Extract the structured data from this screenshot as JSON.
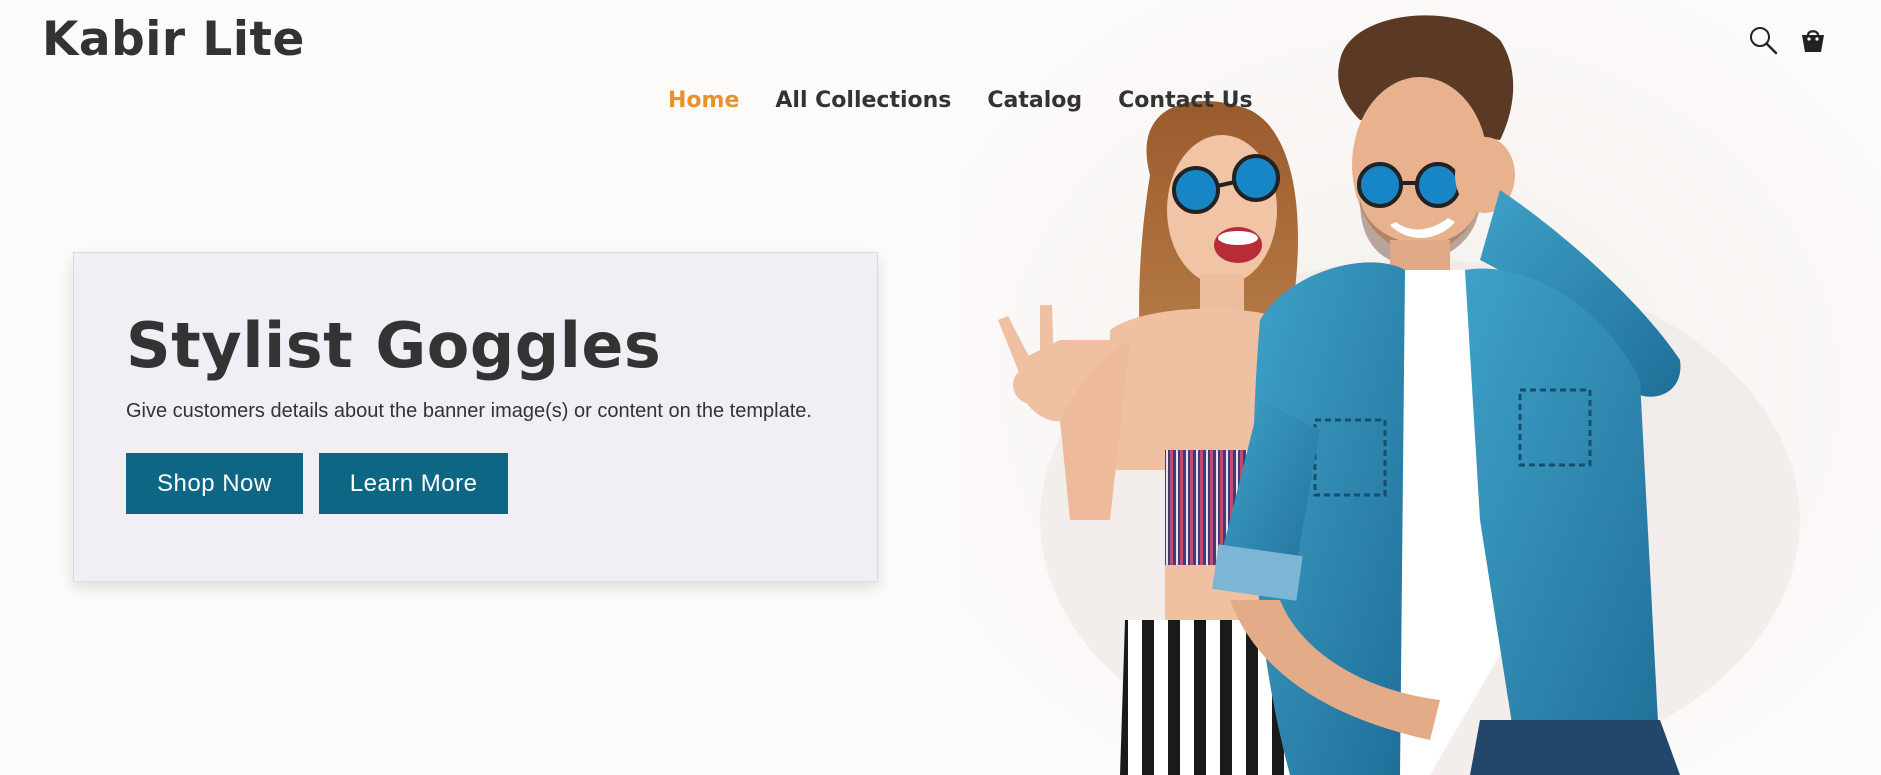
{
  "brand": {
    "name": "Kabir Lite"
  },
  "nav": {
    "items": [
      {
        "label": "Home",
        "active": true
      },
      {
        "label": "All Collections",
        "active": false
      },
      {
        "label": "Catalog",
        "active": false
      },
      {
        "label": "Contact Us",
        "active": false
      }
    ],
    "active_color": "#e8922b"
  },
  "header_icons": [
    "search-icon",
    "shopping-bag-icon"
  ],
  "banner": {
    "title": "Stylist Goggles",
    "text": "Give customers details about the banner image(s) or content on the template.",
    "buttons": {
      "primary_label": "Shop Now",
      "secondary_label": "Learn More"
    },
    "button_color": "#0d6784",
    "card_color": "#f1eef6"
  },
  "hero_image": {
    "subject": "couple-wearing-blue-sunglasses"
  }
}
